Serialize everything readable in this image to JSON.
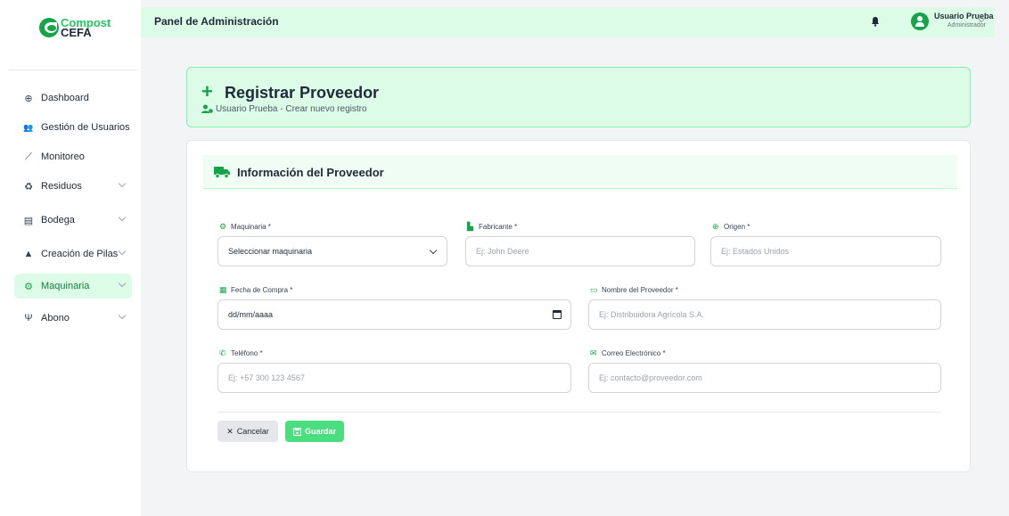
{
  "brand": {
    "line1": "Compost",
    "line2": "CEFA"
  },
  "sidebar": {
    "items": [
      {
        "label": "Dashboard",
        "icon": "globe-icon",
        "glyph": "⊕"
      },
      {
        "label": "Gestión de Usuarios",
        "icon": "users-icon",
        "glyph": "👥"
      },
      {
        "label": "Monitoreo",
        "icon": "chart-line-icon",
        "glyph": "⟋"
      },
      {
        "label": "Residuos",
        "icon": "recycle-icon",
        "glyph": "♻"
      },
      {
        "label": "Bodega",
        "icon": "warehouse-icon",
        "glyph": "▤"
      },
      {
        "label": "Creación de Pilas",
        "icon": "mountain-icon",
        "glyph": "▲"
      },
      {
        "label": "Maquinaria",
        "icon": "cogs-icon",
        "glyph": "⚙"
      },
      {
        "label": "Abono",
        "icon": "seedling-icon",
        "glyph": "Ψ"
      }
    ]
  },
  "header": {
    "title": "Panel de Administración",
    "user_name": "Usuario Prueba",
    "user_role": "Administrador"
  },
  "banner": {
    "title": "Registrar Proveedor",
    "subtitle": "Usuario Prueba - Crear nuevo registro"
  },
  "card": {
    "title": "Información del Proveedor"
  },
  "form": {
    "maquinaria": {
      "label": "Maquinaria *",
      "value": "Seleccionar maquinaria"
    },
    "fabricante": {
      "label": "Fabricante *",
      "placeholder": "Ej: John Deere"
    },
    "origen": {
      "label": "Origen *",
      "placeholder": "Ej: Estados Unidos"
    },
    "fecha": {
      "label": "Fecha de Compra *",
      "value": "dd/mm/aaaa"
    },
    "proveedor": {
      "label": "Nombre del Proveedor *",
      "placeholder": "Ej: Distribuidora Agrícola S.A."
    },
    "telefono": {
      "label": "Teléfono *",
      "placeholder": "Ej: +57 300 123 4567"
    },
    "correo": {
      "label": "Correo Electrónico *",
      "placeholder": "Ej: contacto@proveedor.com"
    }
  },
  "actions": {
    "cancel": "Cancelar",
    "save": "Guardar"
  },
  "colors": {
    "accent": "#16a34a",
    "accent_light": "#dcfce7",
    "save": "#4ade80"
  }
}
